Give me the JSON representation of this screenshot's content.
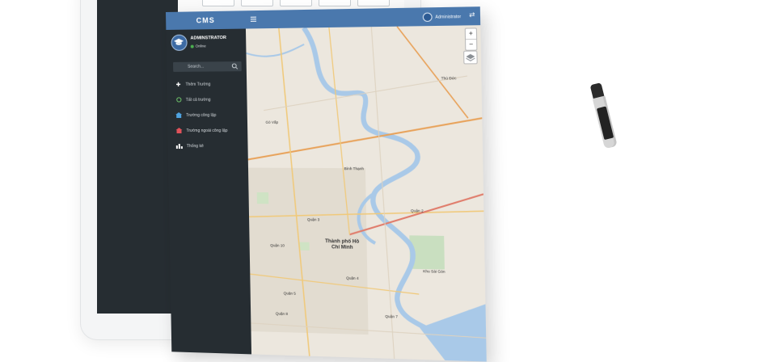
{
  "sidebar": {
    "brand": "CMS",
    "user": {
      "name": "ADMINSTRATOR",
      "status": "Online"
    },
    "search": {
      "placeholder": "Search..."
    },
    "items": [
      {
        "label": "Thêm Trường",
        "icon": "plus-icon"
      },
      {
        "label": "Tất cả trường",
        "icon": "circle-icon"
      },
      {
        "label": "Trường công lập",
        "icon": "school-icon"
      },
      {
        "label": "Trường ngoài công lập",
        "icon": "school-icon"
      },
      {
        "label": "Thống kê",
        "icon": "bar-chart-icon"
      }
    ]
  },
  "topbar": {
    "account": "Administrator"
  },
  "map": {
    "zoom_in": "+",
    "zoom_out": "−",
    "labels": [
      "Thủ Đức",
      "Gò Vấp",
      "Bình Thạnh",
      "Quận 2",
      "Quận 3",
      "Quận 10",
      "Thành phố Hồ Chí Minh",
      "Quận 4",
      "Quận 8",
      "Quận 7",
      "Quận 5",
      "Khu Sài Gòn"
    ]
  },
  "colors": {
    "header": "#4a78ad",
    "sidebar": "#262d32",
    "river": "#a9c9e8"
  }
}
